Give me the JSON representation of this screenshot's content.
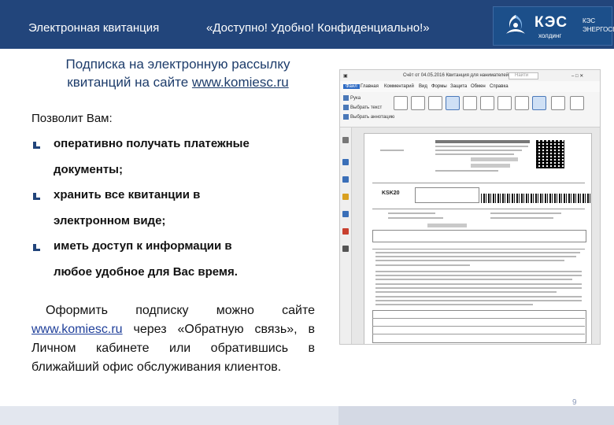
{
  "header": {
    "title": "Электронная квитанция",
    "slogan": "«Доступно! Удобно! Конфиденциально!»",
    "logo": {
      "name": "КЭС",
      "holding": "холдинг",
      "sub1": "КЭС",
      "sub2": "ЭНЕРГОСБЫТ"
    }
  },
  "subtitle": {
    "line1": "Подписка на электронную рассылку",
    "line2": "квитанций на сайте",
    "link": "www.komiesc.ru"
  },
  "allows": "Позволит Вам:",
  "bullets": [
    {
      "line1": "оперативно получать платежные",
      "line2": "документы;"
    },
    {
      "line1": "хранить все квитанции в",
      "line2": "электронном виде;"
    },
    {
      "line1": "иметь доступ к информации в",
      "line2": "любое удобное для Вас время."
    }
  ],
  "paragraph": {
    "part1": "Оформить подписку можно сайте",
    "link": "www.komiesc.ru",
    "part2": " через «Обратную связь», в Личном кабинете или обратившись в ближайший офис обслуживания клиентов."
  },
  "page_number": "9",
  "screenshot": {
    "titlebar": "Счёт от 04.05.2016 Квитанция для нанимателей...",
    "search_placeholder": "Найти",
    "menu": [
      "Файл",
      "Главная",
      "Комментарий",
      "Вид",
      "Формы",
      "Защита",
      "Обмен",
      "Справка"
    ],
    "ribbon_left": [
      "Рука",
      "Выбрать текст",
      "Выбрать аннотацию"
    ],
    "tools": [
      "Масштаб",
      "Увеличение",
      "Снимок",
      "Буфер обмена",
      "Комментарий",
      "Создать",
      "Изменить",
      "Печатная машинка",
      "Подпись",
      "Заполнить",
      "Вставка"
    ],
    "ksk": "KSK20"
  },
  "colors": {
    "header": "#22457b",
    "accent": "#1d3c6b",
    "link": "#1f3f9a"
  }
}
